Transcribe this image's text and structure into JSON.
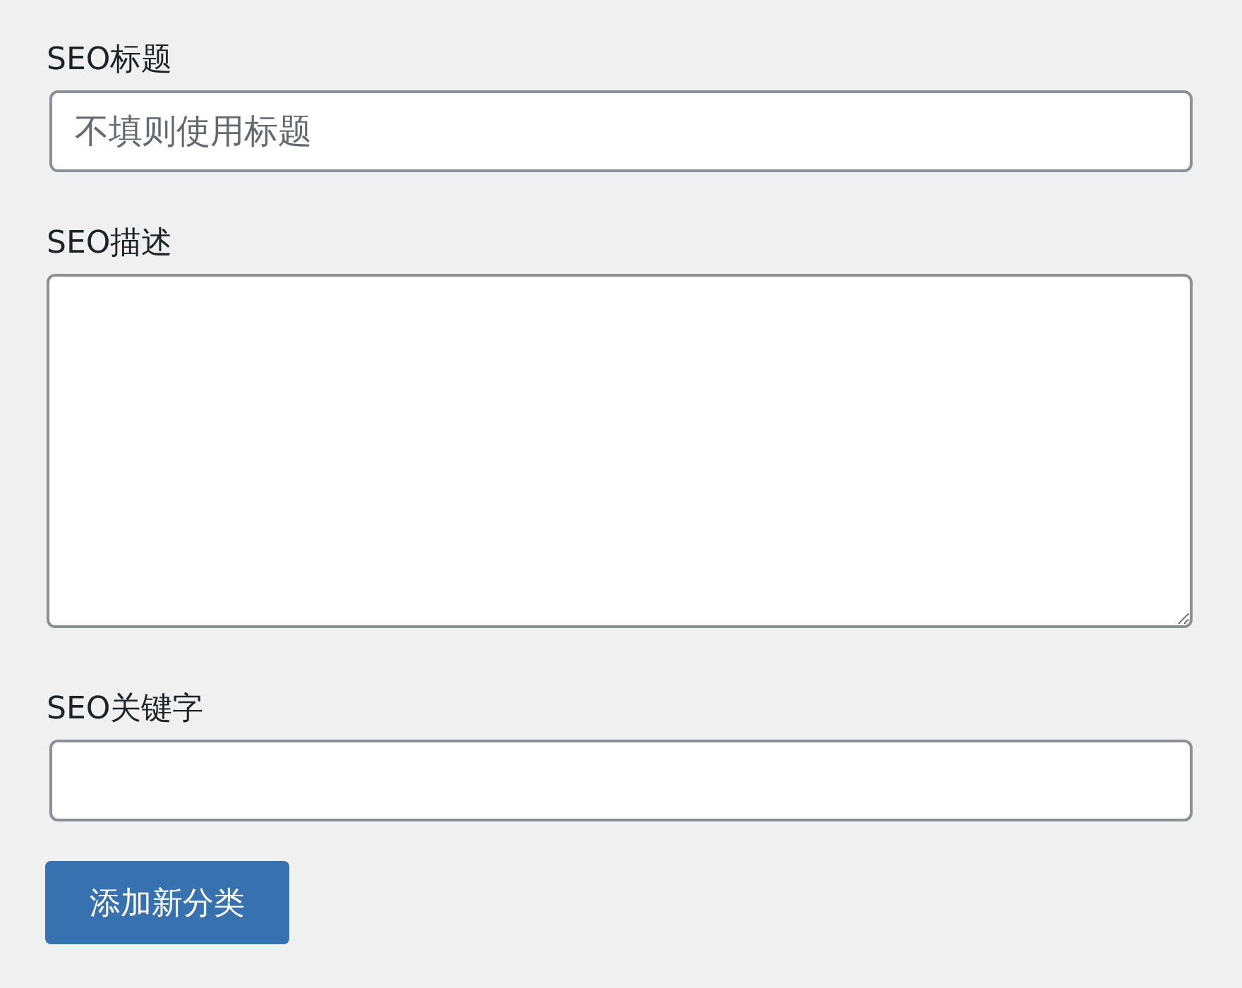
{
  "fields": [
    {
      "kind": "input",
      "label": "SEO标题",
      "placeholder": "不填则使用标题"
    },
    {
      "kind": "textarea",
      "label": "SEO描述"
    },
    {
      "kind": "input",
      "label": "SEO关键字"
    }
  ],
  "submit_button": {
    "label": "添加新分类"
  }
}
